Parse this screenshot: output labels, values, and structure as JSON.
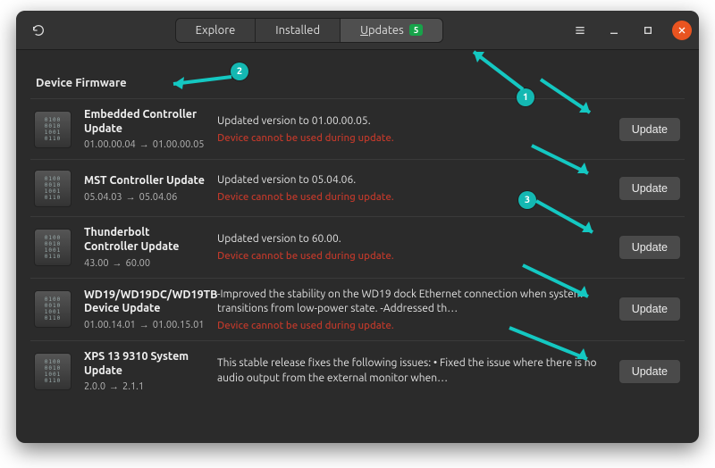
{
  "titlebar": {
    "tabs": {
      "explore": "Explore",
      "installed": "Installed",
      "updates_prefix": "U",
      "updates_rest": "pdates",
      "updates_badge": "5"
    }
  },
  "section": {
    "title": "Device Firmware"
  },
  "warning_text": "Device cannot be used during update.",
  "action_label": "Update",
  "items": [
    {
      "name": "Embedded Controller Update",
      "ver_from": "01.00.00.04",
      "ver_to": "01.00.00.05",
      "desc": "Updated version to 01.00.00.05.",
      "warn": true
    },
    {
      "name": "MST Controller Update",
      "ver_from": "05.04.03",
      "ver_to": "05.04.06",
      "desc": "Updated version to 05.04.06.",
      "warn": true
    },
    {
      "name": "Thunderbolt Controller Update",
      "ver_from": "43.00",
      "ver_to": "60.00",
      "desc": "Updated version to 60.00.",
      "warn": true
    },
    {
      "name": "WD19/WD19DC/WD19TB Device Update",
      "ver_from": "01.00.14.01",
      "ver_to": "01.00.15.01",
      "desc": "-Improved the stability on the WD19 dock Ethernet connection when system transitions from low-power state.  -Addressed th…",
      "warn": true
    },
    {
      "name": "XPS 13 9310 System Update",
      "ver_from": "2.0.0",
      "ver_to": "2.1.1",
      "desc": "This stable release fixes the following issues:  • Fixed the issue where there is no audio output from the external monitor when…",
      "warn": false
    }
  ],
  "annotations": {
    "n1": "1",
    "n2": "2",
    "n3": "3"
  }
}
